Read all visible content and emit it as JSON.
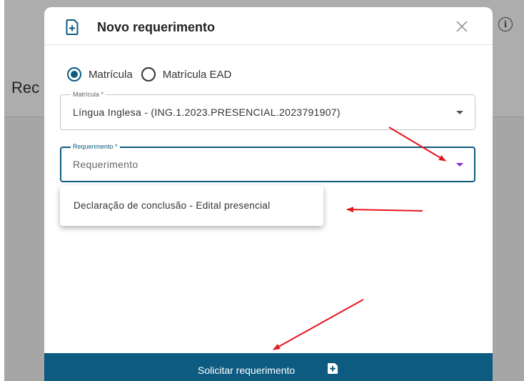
{
  "background": {
    "title_fragment": "Rec",
    "info_icon": "info-circle-icon"
  },
  "dialog": {
    "title": "Novo requerimento",
    "title_icon": "file-add-icon",
    "close_icon": "close-icon",
    "radios": [
      {
        "label": "Matrícula",
        "selected": true
      },
      {
        "label": "Matrícula EAD",
        "selected": false
      }
    ],
    "matricula_field": {
      "label": "Matrícula *",
      "value": "Língua Inglesa - (ING.1.2023.PRESENCIAL.2023791907)"
    },
    "requerimento_field": {
      "label": "Requerimento *",
      "placeholder": "Requerimento"
    },
    "dropdown_options": [
      "Declaração de conclusão - Edital presencial"
    ],
    "submit_label": "Solicitar requerimento",
    "submit_icon": "file-add-icon"
  },
  "colors": {
    "primary": "#0d5b80",
    "annotation_arrow": "#e8141b",
    "dropdown_caret_active": "#8a2be2"
  }
}
